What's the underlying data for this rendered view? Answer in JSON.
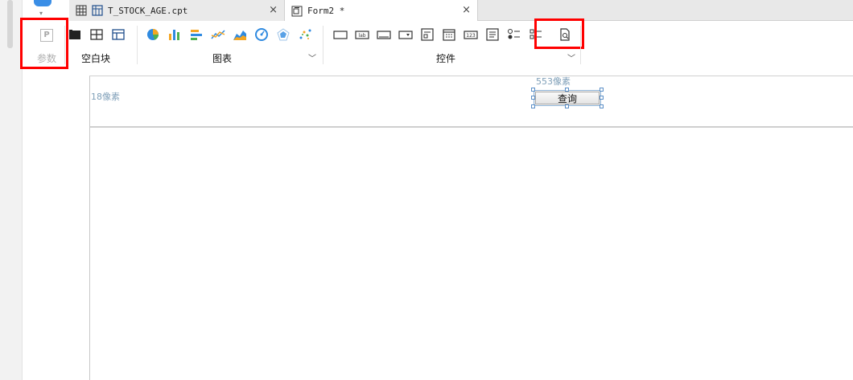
{
  "tabs": [
    {
      "label": "T_STOCK_AGE.cpt",
      "close": "×"
    },
    {
      "label": "Form2 *",
      "close": "×"
    }
  ],
  "toolbar": {
    "param_label": "参数",
    "param_icon_glyph": "P",
    "blank_group_label": "空白块",
    "chart_group_label": "图表",
    "widget_group_label": "控件",
    "chevron": "﹀"
  },
  "canvas": {
    "left_px_label": "18像素",
    "right_px_label": "553像素",
    "query_button_label": "查询"
  },
  "colors": {
    "highlight": "#ff0000",
    "chart_blue": "#2f8ae0",
    "chart_orange": "#f4a623",
    "chart_green": "#4cb050",
    "px_label": "#7f9fb8"
  }
}
